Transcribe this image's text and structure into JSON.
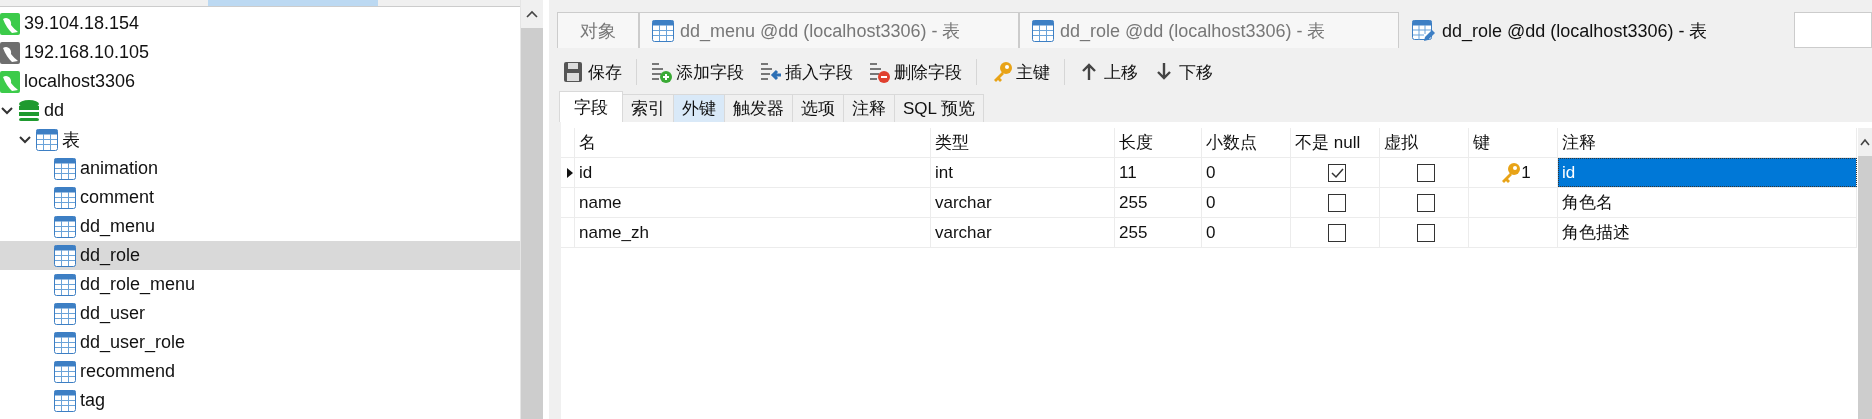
{
  "tree": [
    {
      "label": "39.104.18.154",
      "kind": "connection",
      "connected": true,
      "selected": false
    },
    {
      "label": "192.168.10.105",
      "kind": "connection",
      "connected": false,
      "selected": false
    },
    {
      "label": "localhost3306",
      "kind": "connection",
      "connected": true,
      "selected": false
    },
    {
      "label": "dd",
      "kind": "database",
      "expanded": true,
      "selected": false,
      "children": [
        {
          "label": "表",
          "kind": "folder",
          "expanded": true,
          "selected": false,
          "children": [
            {
              "label": "animation",
              "kind": "table",
              "selected": false
            },
            {
              "label": "comment",
              "kind": "table",
              "selected": false
            },
            {
              "label": "dd_menu",
              "kind": "table",
              "selected": false
            },
            {
              "label": "dd_role",
              "kind": "table",
              "selected": true
            },
            {
              "label": "dd_role_menu",
              "kind": "table",
              "selected": false
            },
            {
              "label": "dd_user",
              "kind": "table",
              "selected": false
            },
            {
              "label": "dd_user_role",
              "kind": "table",
              "selected": false
            },
            {
              "label": "recommend",
              "kind": "table",
              "selected": false
            },
            {
              "label": "tag",
              "kind": "table",
              "selected": false
            }
          ]
        }
      ]
    }
  ],
  "tabs": [
    {
      "label": "对象",
      "kind": "objects",
      "selected": false
    },
    {
      "label": "dd_menu @dd (localhost3306) - 表",
      "kind": "table",
      "selected": false
    },
    {
      "label": "dd_role @dd (localhost3306) - 表",
      "kind": "table",
      "selected": false
    },
    {
      "label": "dd_role @dd (localhost3306) - 表",
      "kind": "design",
      "selected": true
    }
  ],
  "toolbar": [
    {
      "label": "保存",
      "kind": "save"
    },
    {
      "label": "添加字段",
      "kind": "add"
    },
    {
      "label": "插入字段",
      "kind": "insert"
    },
    {
      "label": "删除字段",
      "kind": "delete"
    },
    {
      "label": "主键",
      "kind": "key"
    },
    {
      "label": "上移",
      "kind": "up"
    },
    {
      "label": "下移",
      "kind": "down"
    }
  ],
  "subtabs": [
    {
      "label": "字段",
      "selected": true,
      "hover": false
    },
    {
      "label": "索引",
      "selected": false,
      "hover": false
    },
    {
      "label": "外键",
      "selected": false,
      "hover": true
    },
    {
      "label": "触发器",
      "selected": false,
      "hover": false
    },
    {
      "label": "选项",
      "selected": false,
      "hover": false
    },
    {
      "label": "注释",
      "selected": false,
      "hover": false
    },
    {
      "label": "SQL 预览",
      "selected": false,
      "hover": false
    }
  ],
  "table": {
    "columns": [
      "名",
      "类型",
      "长度",
      "小数点",
      "不是 null",
      "虚拟",
      "键",
      "注释"
    ],
    "rows": [
      {
        "current": true,
        "name": "id",
        "type": "int",
        "length": "11",
        "decimals": "0",
        "not_null": true,
        "virtual": false,
        "key": "1",
        "comment": "id",
        "comment_selected": true
      },
      {
        "current": false,
        "name": "name",
        "type": "varchar",
        "length": "255",
        "decimals": "0",
        "not_null": false,
        "virtual": false,
        "comment": "角色名",
        "comment_selected": false
      },
      {
        "current": false,
        "name": "name_zh",
        "type": "varchar",
        "length": "255",
        "decimals": "0",
        "not_null": false,
        "virtual": false,
        "comment": "角色描述",
        "comment_selected": false
      }
    ]
  }
}
